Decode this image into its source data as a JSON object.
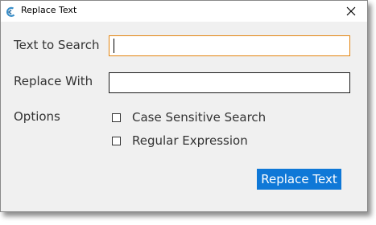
{
  "window": {
    "title": "Replace Text",
    "app_icon": "app-logo-icon",
    "close_icon": "close-icon"
  },
  "form": {
    "search_label": "Text to Search",
    "search_value": "",
    "replace_label": "Replace With",
    "replace_value": "",
    "options_label": "Options",
    "options": [
      {
        "label": "Case Sensitive Search",
        "checked": false
      },
      {
        "label": "Regular Expression",
        "checked": false
      }
    ]
  },
  "actions": {
    "replace_label": "Replace Text"
  },
  "colors": {
    "accent": "#0f78d7",
    "focus_border": "#e3840f",
    "window_bg": "#f0f0f0"
  }
}
